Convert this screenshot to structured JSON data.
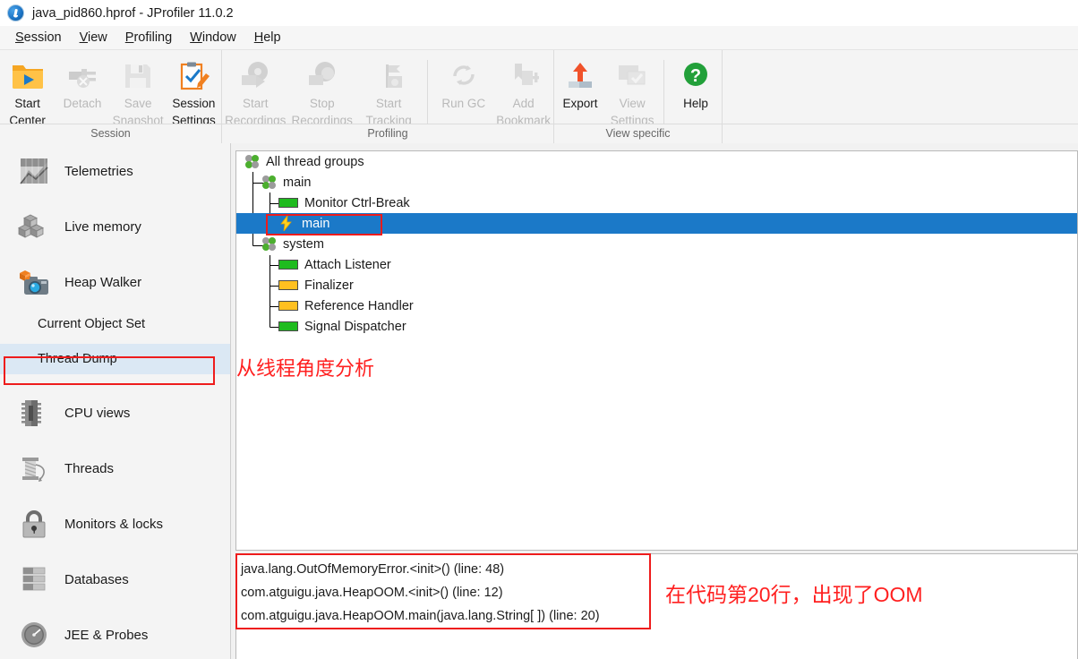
{
  "window": {
    "title": "java_pid860.hprof - JProfiler 11.0.2",
    "app_icon": "jprofiler-logo-icon"
  },
  "menubar": {
    "items": [
      {
        "label": "Session",
        "mnemonic": "S"
      },
      {
        "label": "View",
        "mnemonic": "V"
      },
      {
        "label": "Profiling",
        "mnemonic": "P"
      },
      {
        "label": "Window",
        "mnemonic": "W"
      },
      {
        "label": "Help",
        "mnemonic": "H"
      }
    ]
  },
  "ribbon": {
    "groups": [
      {
        "name": "Session",
        "label": "Session",
        "buttons": [
          {
            "name": "start-center",
            "line1": "Start",
            "line2": "Center",
            "icon": "folder-play-icon",
            "enabled": true
          },
          {
            "name": "detach",
            "line1": "Detach",
            "line2": "",
            "icon": "plug-detach-icon",
            "enabled": false
          },
          {
            "name": "save-snapshot",
            "line1": "Save",
            "line2": "Snapshot",
            "icon": "floppy-disk-icon",
            "enabled": false
          },
          {
            "name": "session-settings",
            "line1": "Session",
            "line2": "Settings",
            "icon": "clipboard-pencil-icon",
            "enabled": true
          }
        ]
      },
      {
        "name": "Profiling",
        "label": "Profiling",
        "buttons": [
          {
            "name": "start-recordings",
            "line1": "Start",
            "line2": "Recordings",
            "icon": "record-start-icon",
            "enabled": false
          },
          {
            "name": "stop-recordings",
            "line1": "Stop",
            "line2": "Recordings",
            "icon": "record-stop-icon",
            "enabled": false
          },
          {
            "name": "start-tracking",
            "line1": "Start",
            "line2": "Tracking",
            "icon": "tracking-icon",
            "enabled": false
          },
          {
            "name": "run-gc",
            "line1": "Run GC",
            "line2": "",
            "icon": "recycle-icon",
            "enabled": false,
            "divider_before": true
          },
          {
            "name": "add-bookmark",
            "line1": "Add",
            "line2": "Bookmark",
            "icon": "bookmark-icon",
            "enabled": false
          }
        ]
      },
      {
        "name": "View specific",
        "label": "View specific",
        "buttons": [
          {
            "name": "export",
            "line1": "Export",
            "line2": "",
            "icon": "export-up-arrow-icon",
            "enabled": true
          },
          {
            "name": "view-settings",
            "line1": "View",
            "line2": "Settings",
            "icon": "window-check-icon",
            "enabled": false
          },
          {
            "name": "help",
            "line1": "Help",
            "line2": "",
            "icon": "green-question-icon",
            "enabled": true,
            "divider_before": true
          }
        ]
      }
    ]
  },
  "sidebar": {
    "items": [
      {
        "name": "telemetries",
        "label": "Telemetries",
        "icon": "chart-telemetry-icon",
        "type": "main"
      },
      {
        "name": "live-memory",
        "label": "Live memory",
        "icon": "cubes-memory-icon",
        "type": "main"
      },
      {
        "name": "heap-walker",
        "label": "Heap Walker",
        "icon": "camera-heap-icon",
        "type": "main"
      },
      {
        "name": "current-object-set",
        "label": "Current Object Set",
        "icon": "",
        "type": "sub",
        "selected": false
      },
      {
        "name": "thread-dump",
        "label": "Thread Dump",
        "icon": "",
        "type": "sub",
        "selected": true
      },
      {
        "name": "cpu-views",
        "label": "CPU views",
        "icon": "cpu-chip-icon",
        "type": "main"
      },
      {
        "name": "threads",
        "label": "Threads",
        "icon": "thread-spool-icon",
        "type": "main"
      },
      {
        "name": "monitors-locks",
        "label": "Monitors & locks",
        "icon": "padlock-icon",
        "type": "main"
      },
      {
        "name": "databases",
        "label": "Databases",
        "icon": "database-stack-icon",
        "type": "main"
      },
      {
        "name": "jee-probes",
        "label": "JEE & Probes",
        "icon": "gauge-dial-icon",
        "type": "main"
      }
    ]
  },
  "thread_tree": {
    "rows": [
      {
        "name": "all-thread-groups",
        "label": "All thread groups",
        "icon": "thread-group-icon",
        "depth": 0,
        "selected": false
      },
      {
        "name": "group-main",
        "label": "main",
        "icon": "thread-group-icon",
        "depth": 1,
        "selected": false
      },
      {
        "name": "thread-monitor-ctrl-break",
        "label": "Monitor Ctrl-Break",
        "icon": "status-bar-green",
        "depth": 2,
        "selected": false
      },
      {
        "name": "thread-main",
        "label": "main",
        "icon": "lightning-bolt-icon",
        "depth": 2,
        "selected": true
      },
      {
        "name": "group-system",
        "label": "system",
        "icon": "thread-group-icon",
        "depth": 1,
        "selected": false
      },
      {
        "name": "thread-attach-listener",
        "label": "Attach Listener",
        "icon": "status-bar-green",
        "depth": 2,
        "selected": false
      },
      {
        "name": "thread-finalizer",
        "label": "Finalizer",
        "icon": "status-bar-yellow",
        "depth": 2,
        "selected": false
      },
      {
        "name": "thread-reference-handler",
        "label": "Reference Handler",
        "icon": "status-bar-yellow",
        "depth": 2,
        "selected": false
      },
      {
        "name": "thread-signal-dispatcher",
        "label": "Signal Dispatcher",
        "icon": "status-bar-green",
        "depth": 2,
        "selected": false
      }
    ]
  },
  "stack_trace": {
    "lines": [
      "java.lang.OutOfMemoryError.<init>() (line: 48)",
      "com.atguigu.java.HeapOOM.<init>() (line: 12)",
      "com.atguigu.java.HeapOOM.main(java.lang.String[ ]) (line: 20)"
    ]
  },
  "annotations": {
    "color": "#ff2020",
    "box_color": "#ee1c1c",
    "notes": [
      {
        "name": "annotation-thread-analysis",
        "text": "从线程角度分析"
      },
      {
        "name": "annotation-oom-line",
        "text": "在代码第20行，出现了OOM"
      }
    ]
  },
  "colors": {
    "selection_blue": "#1b79c8",
    "sub_selection": "#dbe8f4",
    "thread_running": "#1fbb1f",
    "thread_waiting": "#ffc020",
    "accent_orange": "#f08020",
    "help_green": "#22a03a"
  }
}
